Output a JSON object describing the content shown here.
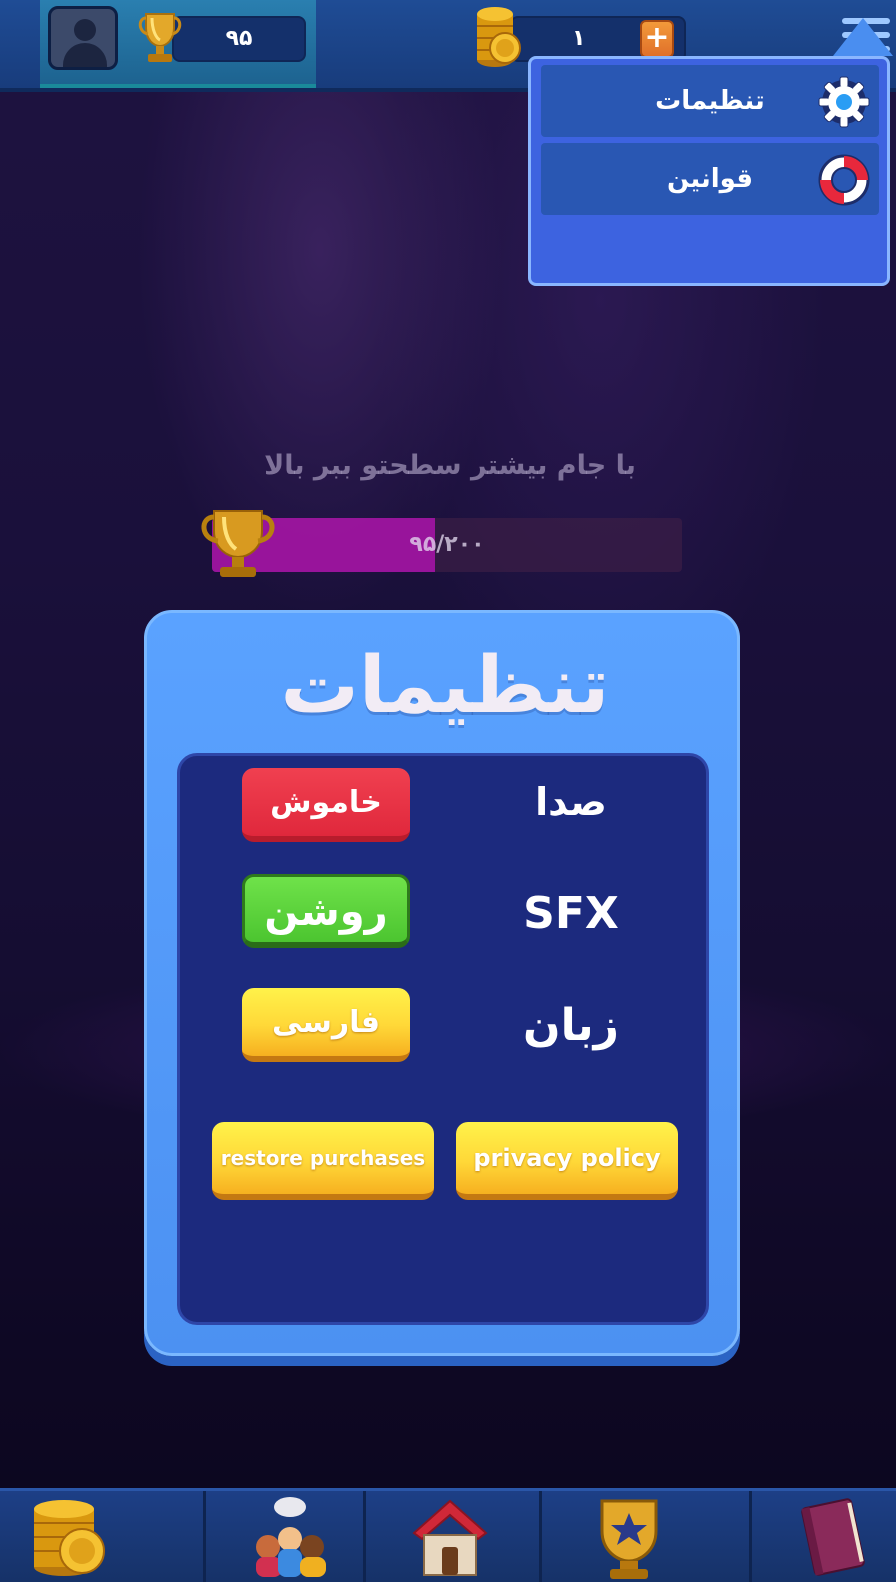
{
  "header": {
    "trophy_count": "۹۵",
    "coin_count": "۱",
    "plus_label": "+"
  },
  "menu": {
    "items": [
      {
        "label": "تنظیمات",
        "icon": "gear-icon"
      },
      {
        "label": "قوانین",
        "icon": "lifebuoy-icon"
      }
    ]
  },
  "progress": {
    "title": "با جام بیشتر سطحتو ببر بالا",
    "text": "۹۵/۲۰۰",
    "value": 95,
    "max": 200
  },
  "settings": {
    "title": "تنظیمات",
    "rows": [
      {
        "label": "صدا",
        "value": "خاموش",
        "color": "#e8283c"
      },
      {
        "label": "SFX",
        "value": "روشن",
        "color": "#4cc530"
      },
      {
        "label": "زبان",
        "value": "فارسی",
        "color": "#ffd838"
      }
    ],
    "privacy_label": "privacy policy",
    "restore_label": "restore purchases"
  },
  "nav": {
    "items": [
      "coins-icon",
      "friends-icon",
      "home-icon",
      "achievements-icon",
      "book-icon"
    ]
  },
  "colors": {
    "dialog": "#5aa2ff",
    "dialog_inner": "#1c2a7e",
    "menu": "#3d63e0"
  }
}
